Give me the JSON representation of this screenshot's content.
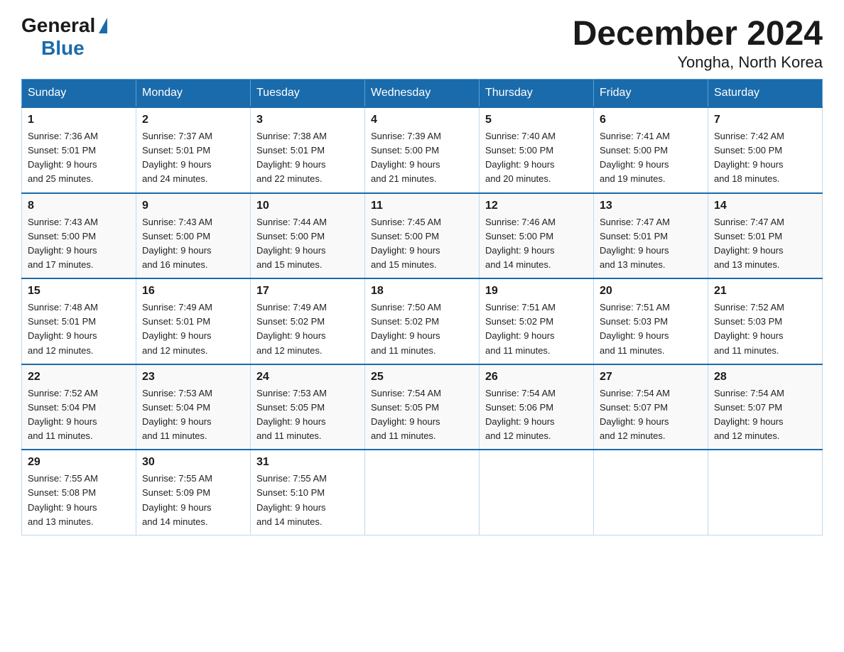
{
  "header": {
    "logo_general": "General",
    "logo_blue": "Blue",
    "title": "December 2024",
    "subtitle": "Yongha, North Korea"
  },
  "days_of_week": [
    "Sunday",
    "Monday",
    "Tuesday",
    "Wednesday",
    "Thursday",
    "Friday",
    "Saturday"
  ],
  "weeks": [
    [
      {
        "num": "1",
        "sunrise": "7:36 AM",
        "sunset": "5:01 PM",
        "daylight": "9 hours and 25 minutes."
      },
      {
        "num": "2",
        "sunrise": "7:37 AM",
        "sunset": "5:01 PM",
        "daylight": "9 hours and 24 minutes."
      },
      {
        "num": "3",
        "sunrise": "7:38 AM",
        "sunset": "5:01 PM",
        "daylight": "9 hours and 22 minutes."
      },
      {
        "num": "4",
        "sunrise": "7:39 AM",
        "sunset": "5:00 PM",
        "daylight": "9 hours and 21 minutes."
      },
      {
        "num": "5",
        "sunrise": "7:40 AM",
        "sunset": "5:00 PM",
        "daylight": "9 hours and 20 minutes."
      },
      {
        "num": "6",
        "sunrise": "7:41 AM",
        "sunset": "5:00 PM",
        "daylight": "9 hours and 19 minutes."
      },
      {
        "num": "7",
        "sunrise": "7:42 AM",
        "sunset": "5:00 PM",
        "daylight": "9 hours and 18 minutes."
      }
    ],
    [
      {
        "num": "8",
        "sunrise": "7:43 AM",
        "sunset": "5:00 PM",
        "daylight": "9 hours and 17 minutes."
      },
      {
        "num": "9",
        "sunrise": "7:43 AM",
        "sunset": "5:00 PM",
        "daylight": "9 hours and 16 minutes."
      },
      {
        "num": "10",
        "sunrise": "7:44 AM",
        "sunset": "5:00 PM",
        "daylight": "9 hours and 15 minutes."
      },
      {
        "num": "11",
        "sunrise": "7:45 AM",
        "sunset": "5:00 PM",
        "daylight": "9 hours and 15 minutes."
      },
      {
        "num": "12",
        "sunrise": "7:46 AM",
        "sunset": "5:00 PM",
        "daylight": "9 hours and 14 minutes."
      },
      {
        "num": "13",
        "sunrise": "7:47 AM",
        "sunset": "5:01 PM",
        "daylight": "9 hours and 13 minutes."
      },
      {
        "num": "14",
        "sunrise": "7:47 AM",
        "sunset": "5:01 PM",
        "daylight": "9 hours and 13 minutes."
      }
    ],
    [
      {
        "num": "15",
        "sunrise": "7:48 AM",
        "sunset": "5:01 PM",
        "daylight": "9 hours and 12 minutes."
      },
      {
        "num": "16",
        "sunrise": "7:49 AM",
        "sunset": "5:01 PM",
        "daylight": "9 hours and 12 minutes."
      },
      {
        "num": "17",
        "sunrise": "7:49 AM",
        "sunset": "5:02 PM",
        "daylight": "9 hours and 12 minutes."
      },
      {
        "num": "18",
        "sunrise": "7:50 AM",
        "sunset": "5:02 PM",
        "daylight": "9 hours and 11 minutes."
      },
      {
        "num": "19",
        "sunrise": "7:51 AM",
        "sunset": "5:02 PM",
        "daylight": "9 hours and 11 minutes."
      },
      {
        "num": "20",
        "sunrise": "7:51 AM",
        "sunset": "5:03 PM",
        "daylight": "9 hours and 11 minutes."
      },
      {
        "num": "21",
        "sunrise": "7:52 AM",
        "sunset": "5:03 PM",
        "daylight": "9 hours and 11 minutes."
      }
    ],
    [
      {
        "num": "22",
        "sunrise": "7:52 AM",
        "sunset": "5:04 PM",
        "daylight": "9 hours and 11 minutes."
      },
      {
        "num": "23",
        "sunrise": "7:53 AM",
        "sunset": "5:04 PM",
        "daylight": "9 hours and 11 minutes."
      },
      {
        "num": "24",
        "sunrise": "7:53 AM",
        "sunset": "5:05 PM",
        "daylight": "9 hours and 11 minutes."
      },
      {
        "num": "25",
        "sunrise": "7:54 AM",
        "sunset": "5:05 PM",
        "daylight": "9 hours and 11 minutes."
      },
      {
        "num": "26",
        "sunrise": "7:54 AM",
        "sunset": "5:06 PM",
        "daylight": "9 hours and 12 minutes."
      },
      {
        "num": "27",
        "sunrise": "7:54 AM",
        "sunset": "5:07 PM",
        "daylight": "9 hours and 12 minutes."
      },
      {
        "num": "28",
        "sunrise": "7:54 AM",
        "sunset": "5:07 PM",
        "daylight": "9 hours and 12 minutes."
      }
    ],
    [
      {
        "num": "29",
        "sunrise": "7:55 AM",
        "sunset": "5:08 PM",
        "daylight": "9 hours and 13 minutes."
      },
      {
        "num": "30",
        "sunrise": "7:55 AM",
        "sunset": "5:09 PM",
        "daylight": "9 hours and 14 minutes."
      },
      {
        "num": "31",
        "sunrise": "7:55 AM",
        "sunset": "5:10 PM",
        "daylight": "9 hours and 14 minutes."
      },
      null,
      null,
      null,
      null
    ]
  ],
  "labels": {
    "sunrise": "Sunrise:",
    "sunset": "Sunset:",
    "daylight": "Daylight:"
  }
}
